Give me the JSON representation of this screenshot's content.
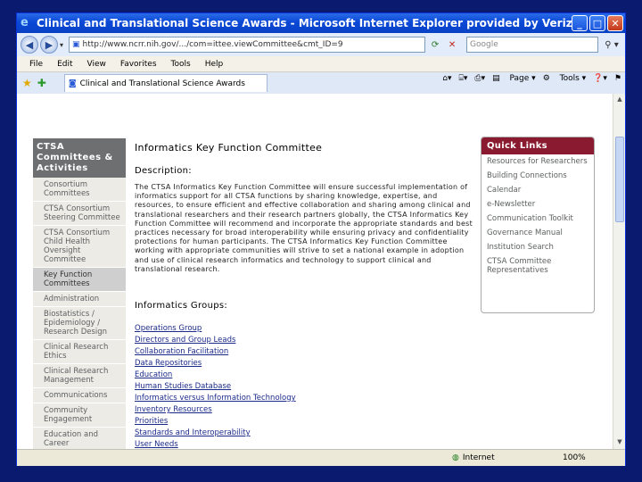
{
  "window": {
    "title": "Clinical and Translational Science Awards - Microsoft Internet Explorer provided by Verizon Online",
    "address": "http://www.ncrr.nih.gov/.../com=ittee.viewCommittee&cmt_ID=9",
    "search_placeholder": "Google",
    "menu": [
      "File",
      "Edit",
      "View",
      "Favorites",
      "Tools",
      "Help"
    ],
    "tab_title": "Clinical and Translational Science Awards",
    "commands": [
      "Page",
      "Tools"
    ],
    "status_zone": "Internet",
    "zoom": "100%"
  },
  "sidebar": {
    "heading": "CTSA Committees & Activities",
    "items": [
      {
        "label": "Consortium Committees",
        "active": false
      },
      {
        "label": "CTSA Consortium Steering Committee",
        "active": false
      },
      {
        "label": "CTSA Consortium Child Health Oversight Committee",
        "active": false
      },
      {
        "label": "Key Function Committees",
        "active": true
      },
      {
        "label": "Administration",
        "active": false
      },
      {
        "label": "Biostatistics / Epidemiology / Research Design",
        "active": false
      },
      {
        "label": "Clinical Research Ethics",
        "active": false
      },
      {
        "label": "Clinical Research Management",
        "active": false
      },
      {
        "label": "Communications",
        "active": false
      },
      {
        "label": "Community Engagement",
        "active": false
      },
      {
        "label": "Education and Career",
        "active": false
      }
    ]
  },
  "main": {
    "title": "Informatics Key Function Committee",
    "description_heading": "Description:",
    "description": "The CTSA Informatics Key Function Committee will ensure successful implementation of informatics support for all CTSA functions by sharing knowledge, expertise, and resources, to ensure efficient and effective collaboration and sharing among clinical and translational researchers and their research partners globally, the CTSA Informatics Key Function Committee will recommend and incorporate the appropriate standards and best practices necessary for broad interoperability while ensuring privacy and confidentiality protections for human participants. The CTSA Informatics Key Function Committee working with appropriate communities will strive to set a national example in adoption and use of clinical research informatics and technology to support clinical and translational research.",
    "groups_heading": "Informatics Groups:",
    "groups": [
      "Operations Group",
      "Directors and Group Leads",
      "Collaboration Facilitation",
      "Data Repositories",
      "Education",
      "Human Studies Database",
      "Informatics versus Information Technology",
      "Inventory Resources",
      "Priorities",
      "Standards and Interoperability",
      "User Needs"
    ]
  },
  "quick_links": {
    "heading": "Quick Links",
    "items": [
      "Resources for Researchers",
      "Building Connections",
      "Calendar",
      "e-Newsletter",
      "Communication Toolkit",
      "Governance Manual",
      "Institution Search",
      "CTSA Committee Representatives"
    ]
  },
  "colors": {
    "quick_head": "#8a1a2f",
    "sidebar_head": "#6d6f70",
    "link": "#1b2a8a"
  }
}
